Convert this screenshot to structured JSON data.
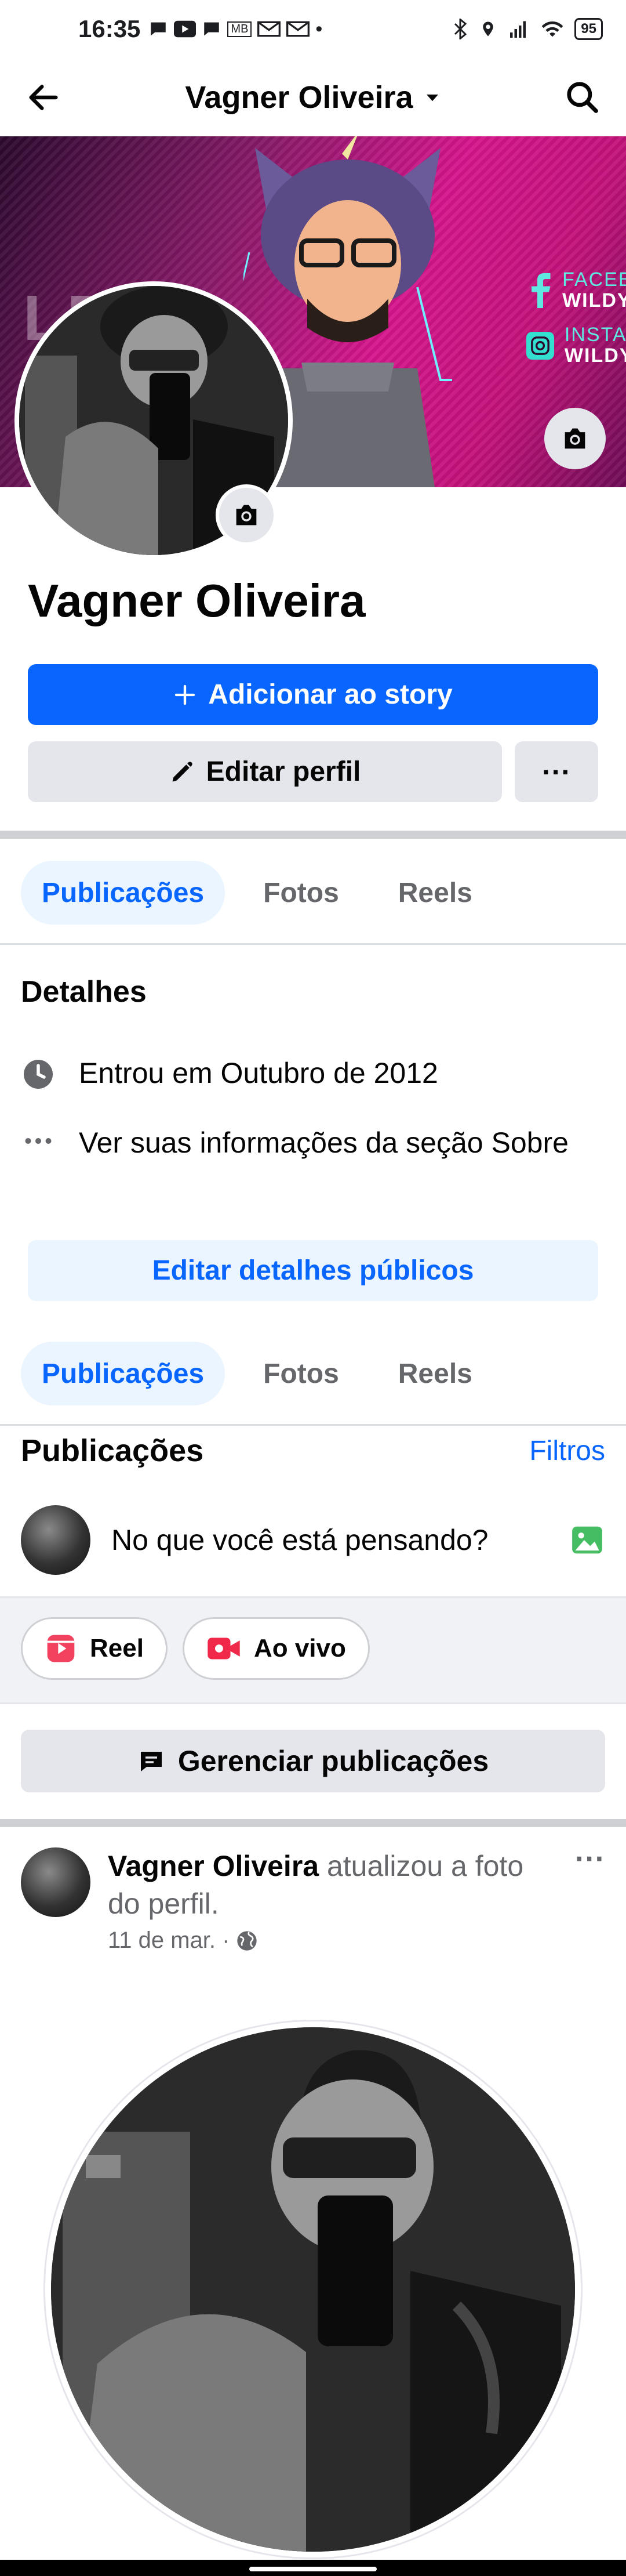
{
  "status_bar": {
    "time": "16:35",
    "battery": "95"
  },
  "nav": {
    "title": "Vagner Oliveira"
  },
  "cover": {
    "big_text": "LD",
    "facebook_label": "FACEBO",
    "facebook_handle": "WILDYH",
    "instagram_label": "INSTAG",
    "instagram_handle": "WILDYH"
  },
  "profile": {
    "name": "Vagner Oliveira",
    "add_story_label": "Adicionar ao story",
    "edit_profile_label": "Editar perfil",
    "more_label": "···"
  },
  "tabs": [
    {
      "label": "Publicações"
    },
    {
      "label": "Fotos"
    },
    {
      "label": "Reels"
    }
  ],
  "details": {
    "title": "Detalhes",
    "joined": "Entrou em Outubro de 2012",
    "about": "Ver suas informações da seção Sobre",
    "edit_button": "Editar detalhes públicos"
  },
  "posts": {
    "title": "Publicações",
    "filters": "Filtros",
    "composer_placeholder": "No que você está pensando?",
    "reel_label": "Reel",
    "live_label": "Ao vivo",
    "manage_label": "Gerenciar publicações"
  },
  "post": {
    "author": "Vagner Oliveira",
    "action": " atualizou a foto do perfil.",
    "date": "11 de mar. ·"
  },
  "colors": {
    "accent": "#0866ff",
    "accent_light": "#ebf5ff",
    "button_gray": "#e4e6eb"
  }
}
